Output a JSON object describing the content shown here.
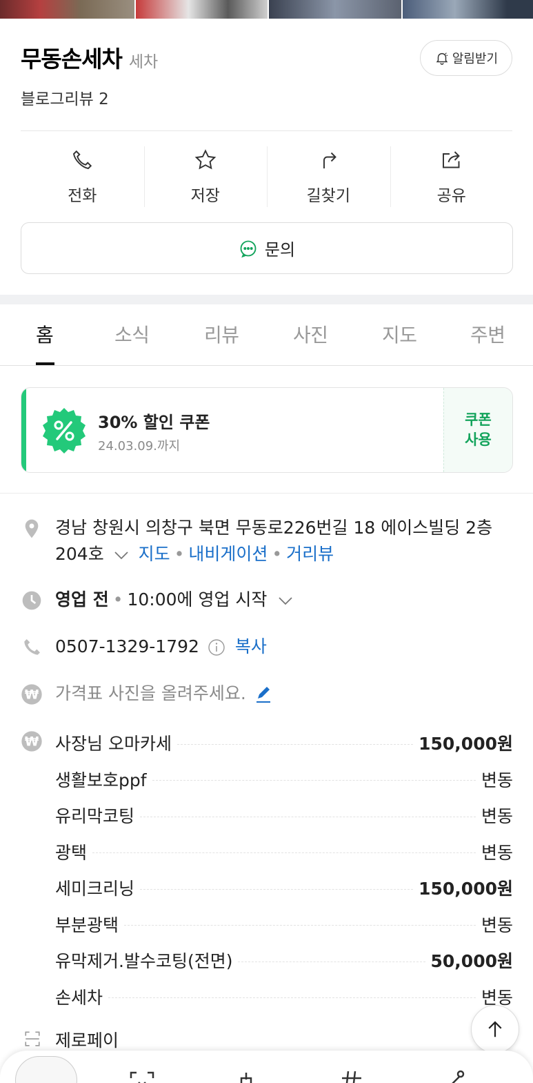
{
  "place": {
    "name": "무동손세차",
    "category": "세차",
    "review_summary": "블로그리뷰 2",
    "alarm_label": "알림받기"
  },
  "actions": [
    {
      "label": "전화",
      "icon": "phone-icon"
    },
    {
      "label": "저장",
      "icon": "star-icon"
    },
    {
      "label": "길찾기",
      "icon": "directions-icon"
    },
    {
      "label": "공유",
      "icon": "share-icon"
    }
  ],
  "inquiry_label": "문의",
  "tabs": [
    "홈",
    "소식",
    "리뷰",
    "사진",
    "지도",
    "주변"
  ],
  "active_tab": "홈",
  "coupon": {
    "title": "30% 할인 쿠폰",
    "valid_until": "24.03.09.까지",
    "use_label_line1": "쿠폰",
    "use_label_line2": "사용"
  },
  "info": {
    "address": "경남 창원시 의창구 북면 무동로226번길 18 에이스빌딩 2층",
    "address_line2": "204호",
    "links": {
      "map": "지도",
      "navigation": "내비게이션",
      "street_view": "거리뷰"
    },
    "hours_status": "영업 전",
    "hours_detail": "10:00에 영업 시작",
    "phone": "0507-1329-1792",
    "copy_label": "복사",
    "price_photo_prompt": "가격표 사진을 올려주세요."
  },
  "menu": [
    {
      "name": "사장님 오마카세",
      "price": "150,000원",
      "bold": true
    },
    {
      "name": "생활보호ppf",
      "price": "변동",
      "bold": false
    },
    {
      "name": "유리막코팅",
      "price": "변동",
      "bold": false
    },
    {
      "name": "광택",
      "price": "변동",
      "bold": false
    },
    {
      "name": "세미크리닝",
      "price": "150,000원",
      "bold": true
    },
    {
      "name": "부분광택",
      "price": "변동",
      "bold": false
    },
    {
      "name": "유막제거.발수코팅(전면)",
      "price": "50,000원",
      "bold": true
    },
    {
      "name": "손세차",
      "price": "변동",
      "bold": false
    }
  ],
  "payment": {
    "label": "제로페이"
  },
  "colors": {
    "accent_green": "#23c97a",
    "link_blue": "#1a6fc9",
    "coupon_text_green": "#12a35b"
  }
}
